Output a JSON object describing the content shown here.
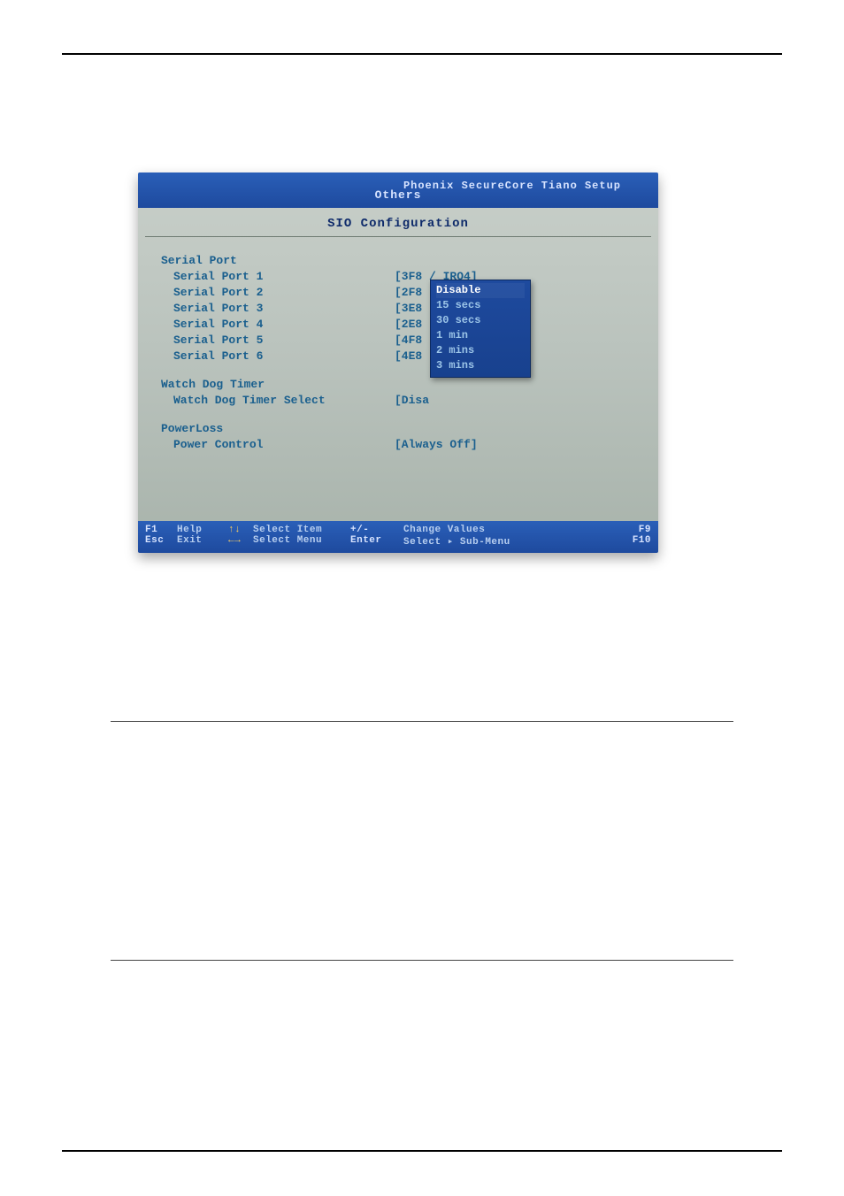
{
  "titlebar": {
    "title": "Phoenix SecureCore Tiano Setup",
    "tab": "Others"
  },
  "subtitle": "SIO Configuration",
  "sections": {
    "serial": {
      "header": "Serial Port",
      "ports": [
        {
          "label": "Serial Port 1",
          "value": "[3F8 / IRQ4]"
        },
        {
          "label": "Serial Port 2",
          "value": "[2F8"
        },
        {
          "label": "Serial Port 3",
          "value": "[3E8"
        },
        {
          "label": "Serial Port 4",
          "value": "[2E8"
        },
        {
          "label": "Serial Port 5",
          "value": "[4F8"
        },
        {
          "label": "Serial Port 6",
          "value": "[4E8"
        }
      ]
    },
    "watchdog": {
      "header": "Watch Dog Timer",
      "item": {
        "label": "Watch Dog Timer Select",
        "value": "[Disa"
      }
    },
    "powerloss": {
      "header": "PowerLoss",
      "item": {
        "label": "Power Control",
        "value": "[Always Off]"
      }
    }
  },
  "dropdown": {
    "options": [
      "Disable",
      "15 secs",
      "30 secs",
      "1 min",
      "2 mins",
      "3 mins"
    ],
    "selected": "Disable"
  },
  "footer": {
    "row1": {
      "k1": "F1",
      "l1": "Help",
      "a1": "↑↓",
      "l2": "Select Item",
      "mid": "+/-",
      "r": "Change Values",
      "end": "F9"
    },
    "row2": {
      "k1": "Esc",
      "l1": "Exit",
      "a1": "←→",
      "l2": "Select Menu",
      "mid": "Enter",
      "r": "Select ▸ Sub-Menu",
      "end": "F10"
    }
  }
}
